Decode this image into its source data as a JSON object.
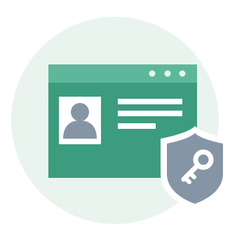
{
  "illustration": {
    "name": "secure-user-profile-window",
    "icons": {
      "window": "browser-window-icon",
      "window_dots": "window-controls-icon",
      "avatar": "user-avatar-icon",
      "text_lines": "text-lines-icon",
      "shield": "shield-icon",
      "key": "key-icon"
    },
    "colors": {
      "background_circle": "#eaf4ef",
      "window_body": "#3c9c7e",
      "window_titlebar": "#5db89b",
      "window_dots": "#e8f5ef",
      "avatar_card": "#ffffff",
      "avatar_figure": "#8595a6",
      "text_lines": "#ffffff",
      "shield_border": "#ffffff",
      "shield_fill": "#8595a6",
      "key": "#ffffff"
    }
  }
}
